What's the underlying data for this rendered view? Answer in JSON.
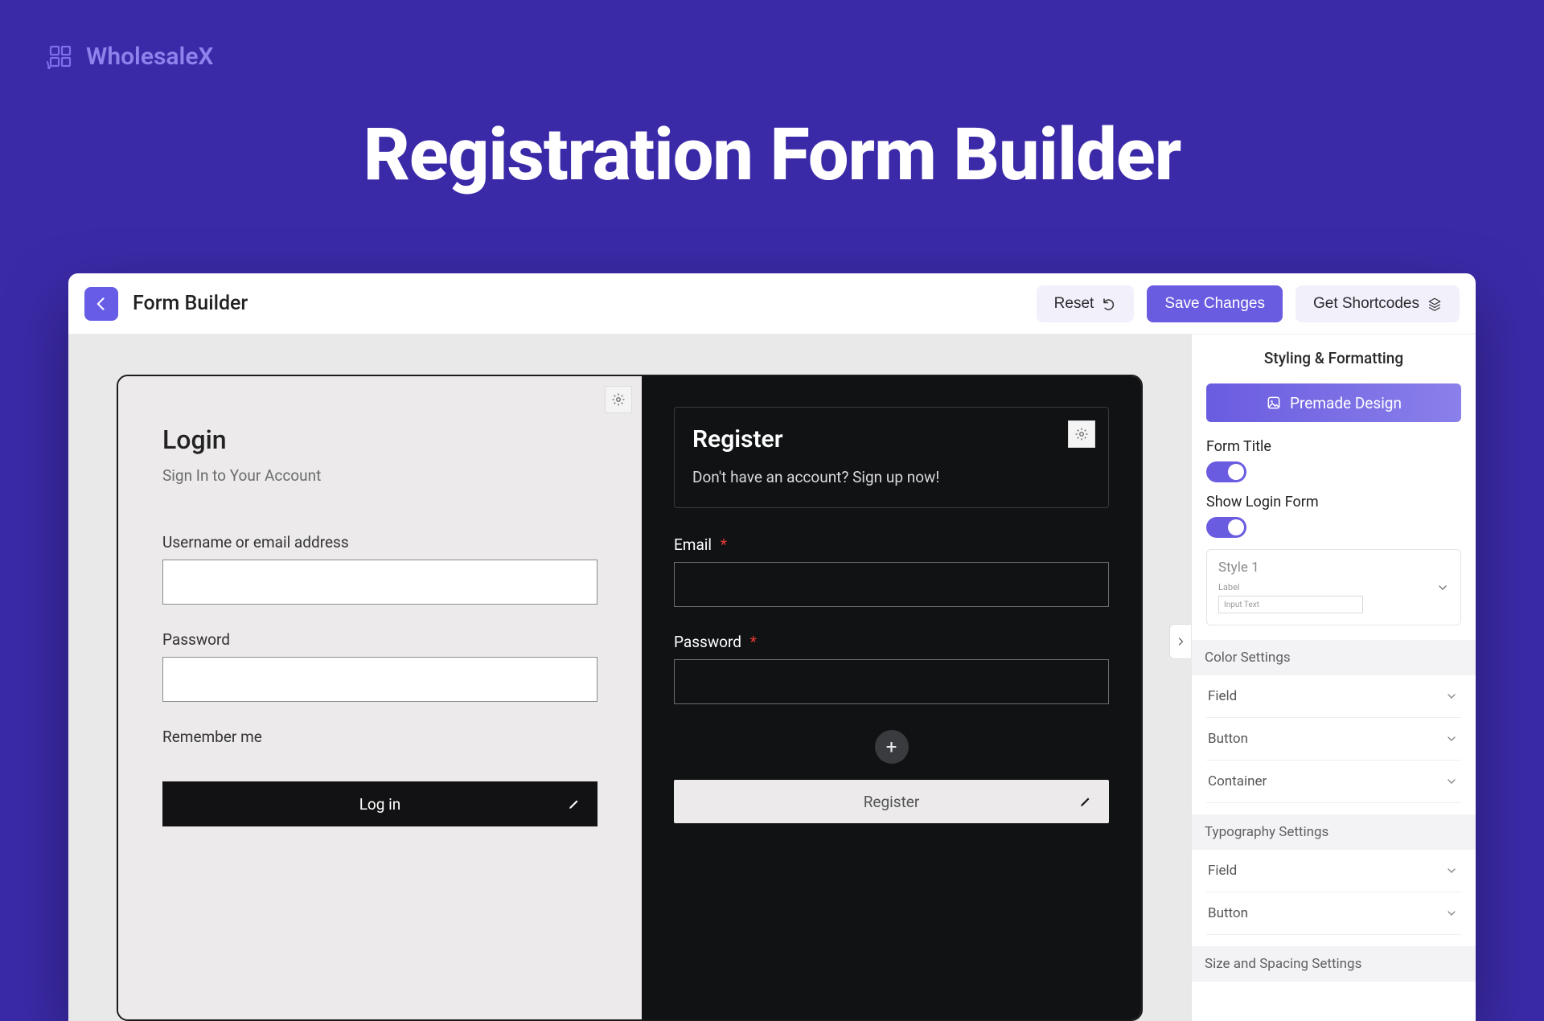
{
  "brand": {
    "name": "WholesaleX"
  },
  "hero": {
    "title": "Registration Form Builder"
  },
  "topbar": {
    "title": "Form Builder",
    "reset": "Reset",
    "save": "Save Changes",
    "shortcodes": "Get Shortcodes"
  },
  "login": {
    "title": "Login",
    "subtitle": "Sign In to Your Account",
    "username_label": "Username or email address",
    "password_label": "Password",
    "remember": "Remember me",
    "submit": "Log in"
  },
  "register": {
    "title": "Register",
    "subtitle": "Don't have an account? Sign up now!",
    "email_label": "Email",
    "password_label": "Password",
    "required_mark": "*",
    "submit": "Register"
  },
  "sidebar": {
    "heading": "Styling & Formatting",
    "premade": "Premade Design",
    "form_title_label": "Form Title",
    "show_login_label": "Show Login Form",
    "style_card": {
      "name": "Style 1",
      "mini_label": "Label",
      "mini_input": "Input Text"
    },
    "color_section": "Color Settings",
    "color_items": {
      "field": "Field",
      "button": "Button",
      "container": "Container"
    },
    "typo_section": "Typography Settings",
    "typo_items": {
      "field": "Field",
      "button": "Button"
    },
    "size_section": "Size and Spacing Settings"
  }
}
